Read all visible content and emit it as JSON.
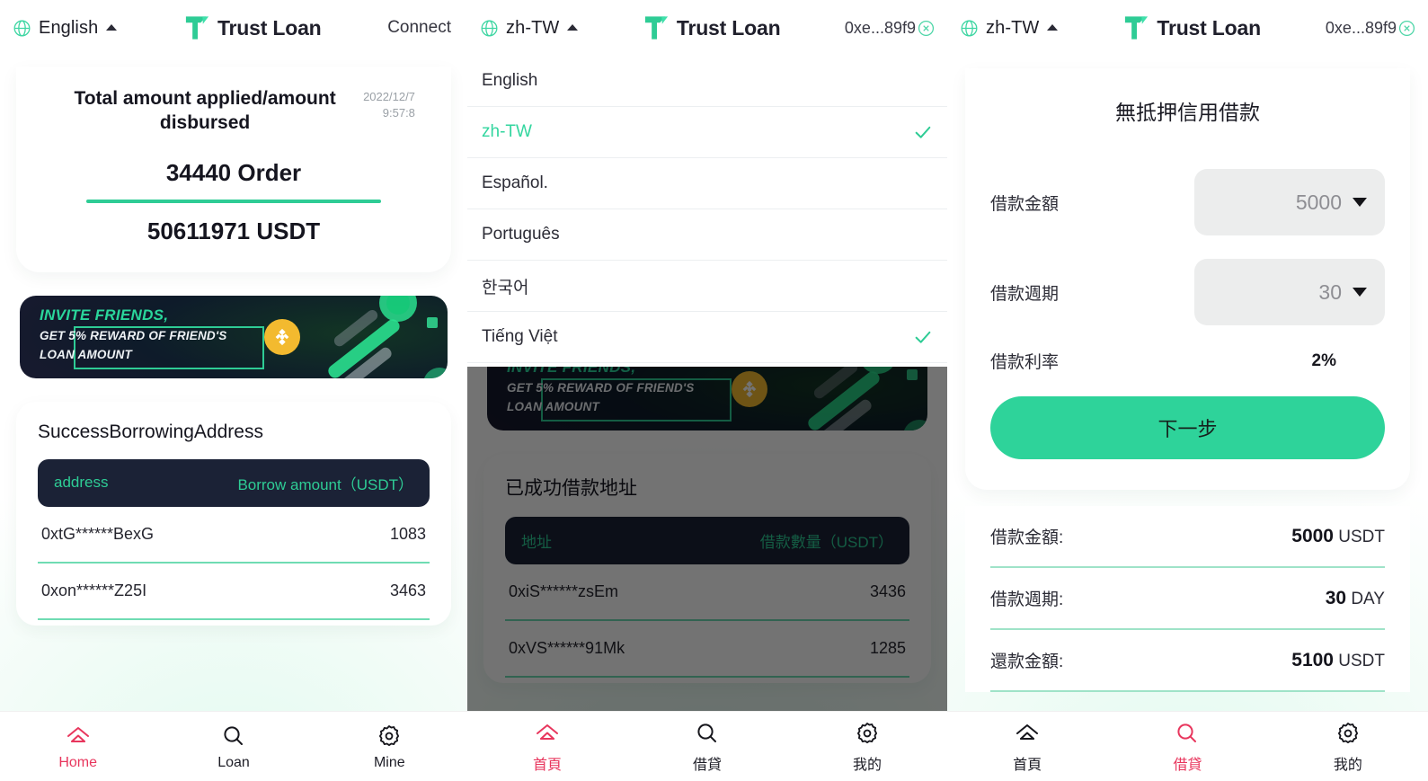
{
  "brand": {
    "name": "Trust Loan",
    "logo_icon": "trust-loan-t-mark"
  },
  "colors": {
    "accent_green": "#2ecc95",
    "accent_pink": "#e8365d",
    "dark_navy": "#1b2236",
    "bnb_gold": "#f3ba2f"
  },
  "panel1": {
    "header": {
      "globe_icon": "globe-icon",
      "language": "English",
      "caret_icon": "caret-up-icon",
      "right_action": "Connect"
    },
    "stat_card": {
      "title": "Total amount applied/amount disbursed",
      "timestamp": "2022/12/7\n9:57:8",
      "orders": "34440 Order",
      "amount": "50611971 USDT"
    },
    "banner": {
      "line1": "INVITE FRIENDS,",
      "line2": "GET 5% REWARD OF FRIEND'S",
      "line3": "LOAN AMOUNT",
      "coin_icon": "bnb-coin-icon"
    },
    "address_table": {
      "title": "SuccessBorrowingAddress",
      "col_address": "address",
      "col_amount": "Borrow amount（USDT）",
      "rows": [
        {
          "address": "0xtG******BexG",
          "amount": "1083"
        },
        {
          "address": "0xon******Z25I",
          "amount": "3463"
        }
      ]
    },
    "nav": [
      {
        "label": "Home",
        "icon": "home-icon",
        "active": true
      },
      {
        "label": "Loan",
        "icon": "search-icon",
        "active": false
      },
      {
        "label": "Mine",
        "icon": "gear-icon",
        "active": false
      }
    ]
  },
  "panel2": {
    "header": {
      "globe_icon": "globe-icon",
      "language": "zh-TW",
      "caret_icon": "caret-up-icon",
      "wallet_address": "0xe...89f9",
      "disconnect_icon": "disconnect-circle-icon"
    },
    "language_menu": [
      {
        "label": "English",
        "selected": false
      },
      {
        "label": "zh-TW",
        "selected": true
      },
      {
        "label": "Español.",
        "selected": false
      },
      {
        "label": "Português",
        "selected": false
      },
      {
        "label": "한국어",
        "selected": false
      },
      {
        "label": "Tiếng Việt",
        "selected": true
      }
    ],
    "banner": {
      "line1": "INVITE FRIENDS,",
      "line2": "GET 5% REWARD OF FRIEND'S",
      "line3": "LOAN AMOUNT",
      "coin_icon": "bnb-coin-icon"
    },
    "address_table": {
      "title": "已成功借款地址",
      "col_address": "地址",
      "col_amount": "借款數量（USDT）",
      "rows": [
        {
          "address": "0xiS******zsEm",
          "amount": "3436"
        },
        {
          "address": "0xVS******91Mk",
          "amount": "1285"
        }
      ]
    },
    "nav": [
      {
        "label": "首頁",
        "icon": "home-icon",
        "active": true
      },
      {
        "label": "借貸",
        "icon": "search-icon",
        "active": false
      },
      {
        "label": "我的",
        "icon": "gear-icon",
        "active": false
      }
    ]
  },
  "panel3": {
    "header": {
      "globe_icon": "globe-icon",
      "language": "zh-TW",
      "caret_icon": "caret-up-icon",
      "wallet_address": "0xe...89f9",
      "disconnect_icon": "disconnect-circle-icon"
    },
    "form": {
      "title": "無抵押信用借款",
      "amount_label": "借款金額",
      "amount_value": "5000",
      "term_label": "借款週期",
      "term_value": "30",
      "rate_label": "借款利率",
      "rate_value": "2%",
      "submit_label": "下一步"
    },
    "summary": [
      {
        "label": "借款金額:",
        "value": "5000",
        "unit": "USDT"
      },
      {
        "label": "借款週期:",
        "value": "30",
        "unit": "DAY"
      },
      {
        "label": "還款金額:",
        "value": "5100",
        "unit": "USDT"
      }
    ],
    "nav": [
      {
        "label": "首頁",
        "icon": "home-icon",
        "active": false
      },
      {
        "label": "借貸",
        "icon": "search-icon",
        "active": true
      },
      {
        "label": "我的",
        "icon": "gear-icon",
        "active": false
      }
    ]
  }
}
